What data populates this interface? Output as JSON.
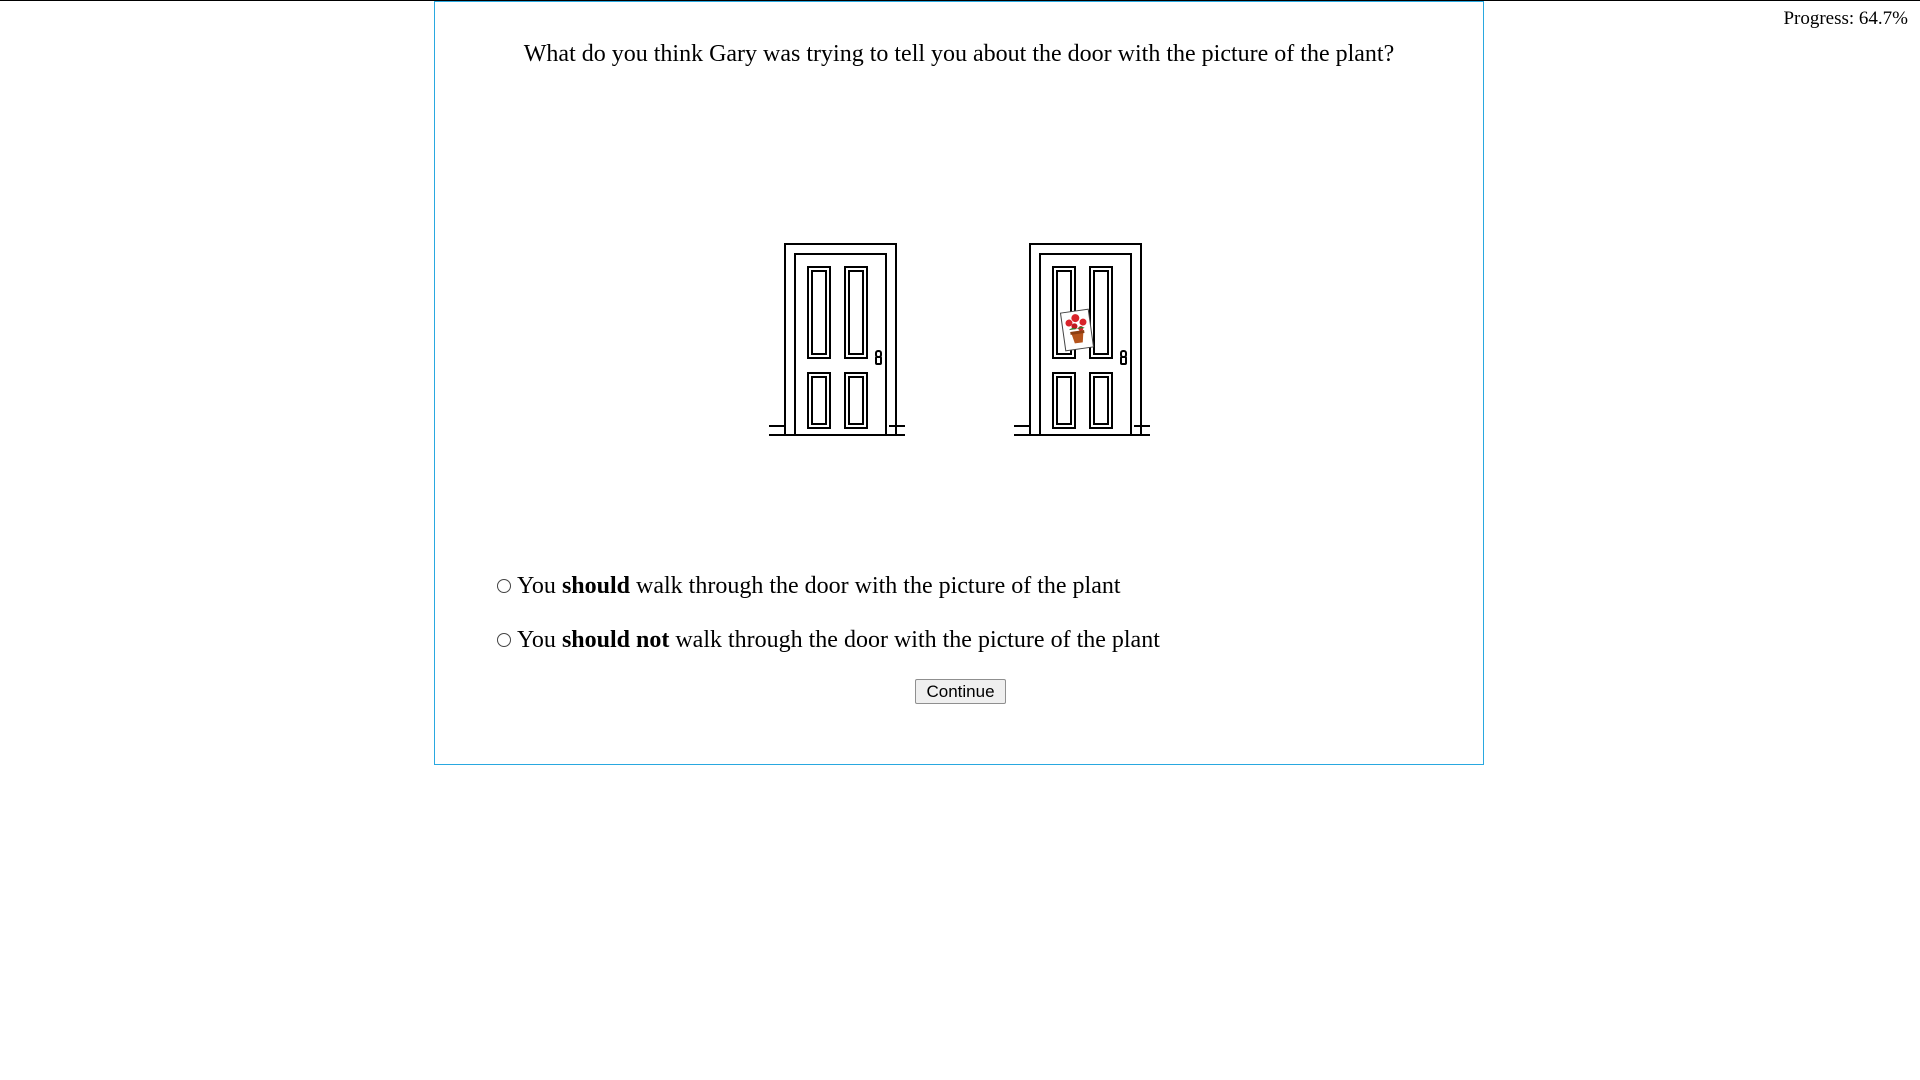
{
  "progress": {
    "text": "Progress: 64.7%",
    "value_percent": 64.7
  },
  "question": {
    "text": "What do you think Gary was trying to tell you about the door with the picture of the plant?"
  },
  "images": {
    "left_door": "plain-door-icon",
    "right_door": "door-with-plant-picture-icon"
  },
  "options": [
    {
      "prefix": "You ",
      "bold": "should",
      "suffix": " walk through the door with the picture of the plant",
      "selected": false
    },
    {
      "prefix": "You ",
      "bold": "should not",
      "suffix": " walk through the door with the picture of the plant",
      "selected": false
    }
  ],
  "continue_label": "Continue",
  "colors": {
    "panel_border": "#29a8e0",
    "plant_flowers": "#d8232a",
    "plant_pot": "#b5541c",
    "leaves": "#2e7d32"
  }
}
